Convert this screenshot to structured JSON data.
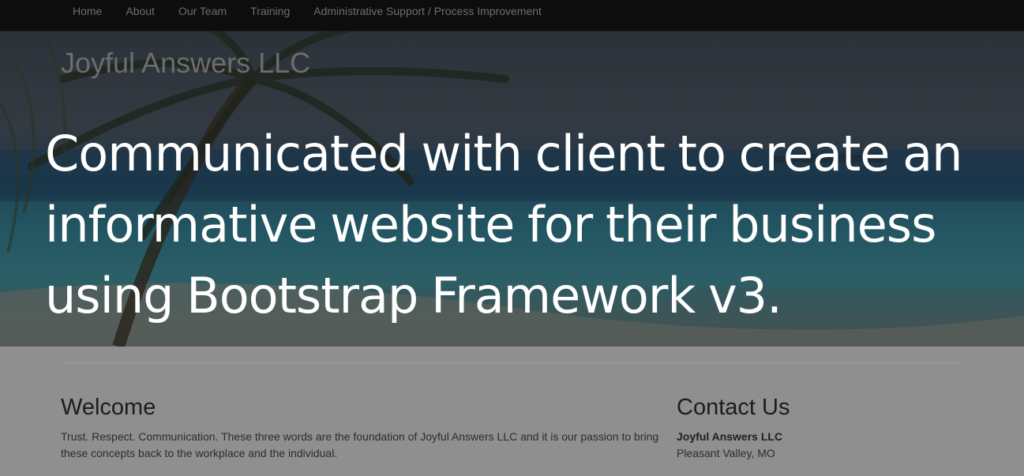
{
  "nav": {
    "items": [
      {
        "label": "Home"
      },
      {
        "label": "About"
      },
      {
        "label": "Our Team"
      },
      {
        "label": "Training"
      },
      {
        "label": "Administrative Support / Process Improvement"
      }
    ]
  },
  "hero": {
    "brand": "Joyful Answers LLC",
    "headline": "Communicated with client to create an informative website for their business using Bootstrap Framework v3."
  },
  "welcome": {
    "title": "Welcome",
    "text": "Trust. Respect. Communication. These three words are the foundation of Joyful Answers LLC and it is our passion to bring these concepts back to the workplace and the individual."
  },
  "contact": {
    "title": "Contact Us",
    "company": "Joyful Answers LLC",
    "location": "Pleasant Valley, MO"
  },
  "colors": {
    "navbar_bg": "#0d0d0d",
    "nav_text": "#6e6e6e",
    "headline": "#ffffff",
    "page_bg": "#8f8f8f"
  }
}
